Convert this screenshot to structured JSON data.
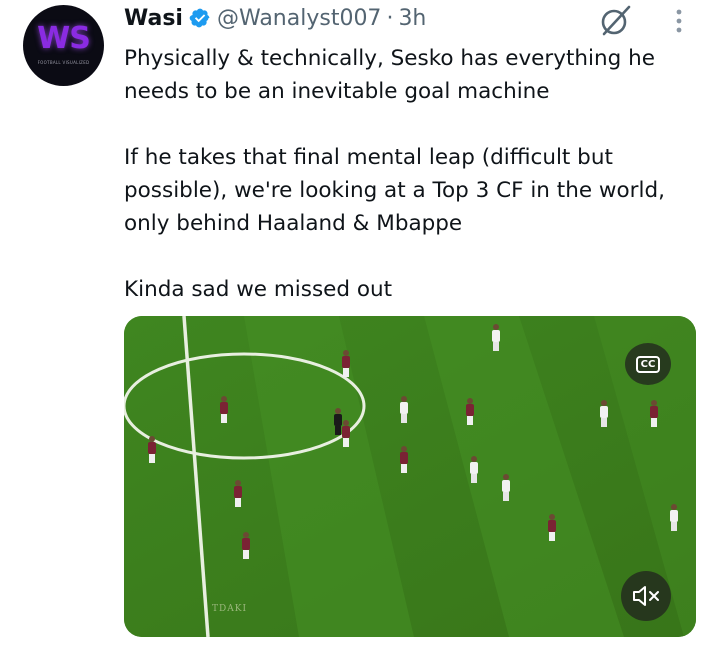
{
  "author": {
    "name": "Wasi",
    "handle": "@Wanalyst007",
    "separator": "·",
    "time": "3h",
    "avatar_text": "WS",
    "avatar_subtext": "FOOTBALL VISUALIZED",
    "verified": true
  },
  "tweet": {
    "text": "Physically & technically, Sesko has everything he needs to be an inevitable goal machine\n\nIf he takes that final mental leap (difficult but possible), we're looking at a Top 3 CF in the world, only behind Haaland & Mbappe\n\nKinda sad we missed out"
  },
  "media": {
    "cc_label": "CC",
    "watermark": "TDAKI"
  },
  "icons": {
    "verified": "verified-badge-icon",
    "grok": "grok-icon",
    "more": "more-options-icon",
    "cc": "closed-captions-icon",
    "mute": "muted-speaker-icon"
  },
  "colors": {
    "verified_blue": "#1d9bf0",
    "muted_text": "#536471",
    "pitch_green": "#3d7d1c"
  }
}
